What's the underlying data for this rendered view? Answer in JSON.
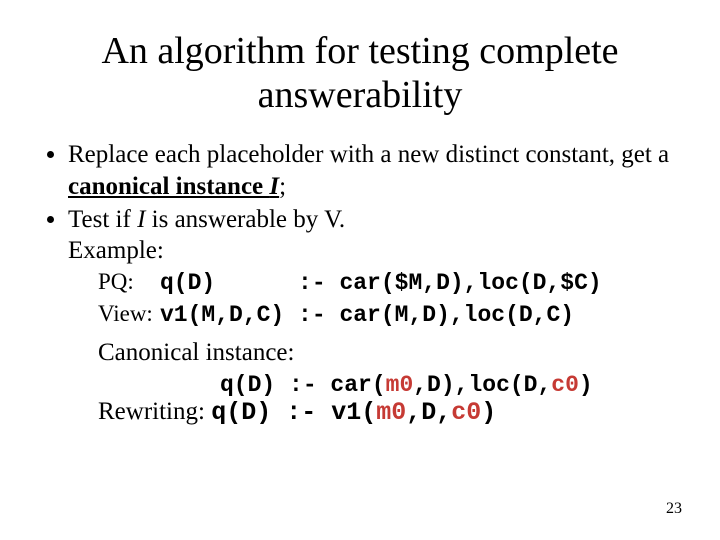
{
  "title": "An algorithm for testing complete answerability",
  "bullets": {
    "b1a": "Replace each placeholder with a new distinct constant, get a ",
    "b1b": "canonical instance ",
    "b1c": "I",
    "b1d": ";",
    "b2a": "Test if ",
    "b2b": "I",
    "b2c": " is answerable by V."
  },
  "example_label": "Example:",
  "code": {
    "pq_label": "PQ:",
    "pq_head": "q(D)",
    "pq_sep": "      :- ",
    "pq_body": "car($M,D),loc(D,$C)",
    "view_label": "View:",
    "view_head": "v1(M,D,C)",
    "view_sep": " :- ",
    "view_body": "car(M,D),loc(D,C)"
  },
  "canonical_label": "Canonical instance:",
  "canonical": {
    "head": "q(D) :- car(",
    "m0": "m0",
    "mid": ",D),loc(D,",
    "c0": "c0",
    "tail": ")"
  },
  "rewrite": {
    "label": "Rewriting: ",
    "head": "q(D) :- v1(",
    "m0": "m0",
    "mid": ",D,",
    "c0": "c0",
    "tail": ")"
  },
  "page_number": "23"
}
